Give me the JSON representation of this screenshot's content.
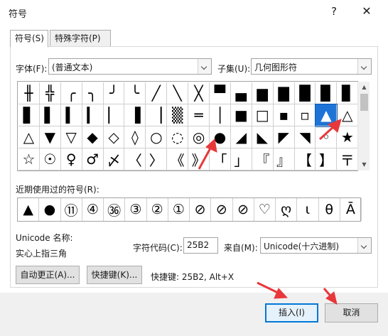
{
  "dialog": {
    "title": "符号",
    "help": "?",
    "close": "✕"
  },
  "tabs": [
    {
      "label": "符号(S)",
      "active": true
    },
    {
      "label": "特殊字符(P)",
      "active": false
    }
  ],
  "font": {
    "label": "字体(F):",
    "value": "(普通文本)"
  },
  "subset": {
    "label": "子集(U):",
    "value": "几何图形符"
  },
  "grid": {
    "rows": [
      [
        "╫",
        "╬",
        "╭",
        "╮",
        "╯",
        "╰",
        "╱",
        "╲",
        "╳",
        "▀",
        "▄",
        "▆",
        "▇",
        "█",
        "▉",
        "▊"
      ],
      [
        "▋",
        "▌",
        "▍",
        "▎",
        "▏",
        "▐",
        "▕",
        "▒",
        "═",
        "│",
        "■",
        "□",
        "▪",
        "▫",
        "▲",
        "△"
      ],
      [
        "△",
        "▼",
        "▽",
        "◆",
        "◇",
        "◊",
        "○",
        "◌",
        "◎",
        "●",
        "◢",
        "◣",
        "◤",
        "◥",
        "◦",
        "★"
      ],
      [
        "☆",
        "☉",
        "♀",
        "♂",
        "〆",
        "〈",
        "〉",
        "《",
        "》",
        "「",
        "」",
        "『",
        "』",
        "【",
        "】",
        "〒"
      ]
    ],
    "selected": "▲"
  },
  "recent": {
    "label": "近期使用过的符号(R):",
    "items": [
      "▲",
      "●",
      "⑪",
      "④",
      "㊱",
      "③",
      "②",
      "①",
      "⊘",
      "⊘",
      "⊘",
      "♡",
      "ღ",
      "ι",
      "θ",
      "Ā"
    ]
  },
  "unicode": {
    "name_label": "Unicode 名称:",
    "name_value": "实心上指三角",
    "code_label": "字符代码(C):",
    "code_value": "25B2",
    "from_label": "来自(M):",
    "from_value": "Unicode(十六进制)"
  },
  "buttons": {
    "autocorrect": "自动更正(A)...",
    "shortcut_key": "快捷键(K)...",
    "shortcut_text": "快捷键: 25B2, Alt+X",
    "insert": "插入(I)",
    "cancel": "取消"
  },
  "colors": {
    "selected_bg": "#1e74d6",
    "annotation_arrow": "#e8373b"
  }
}
